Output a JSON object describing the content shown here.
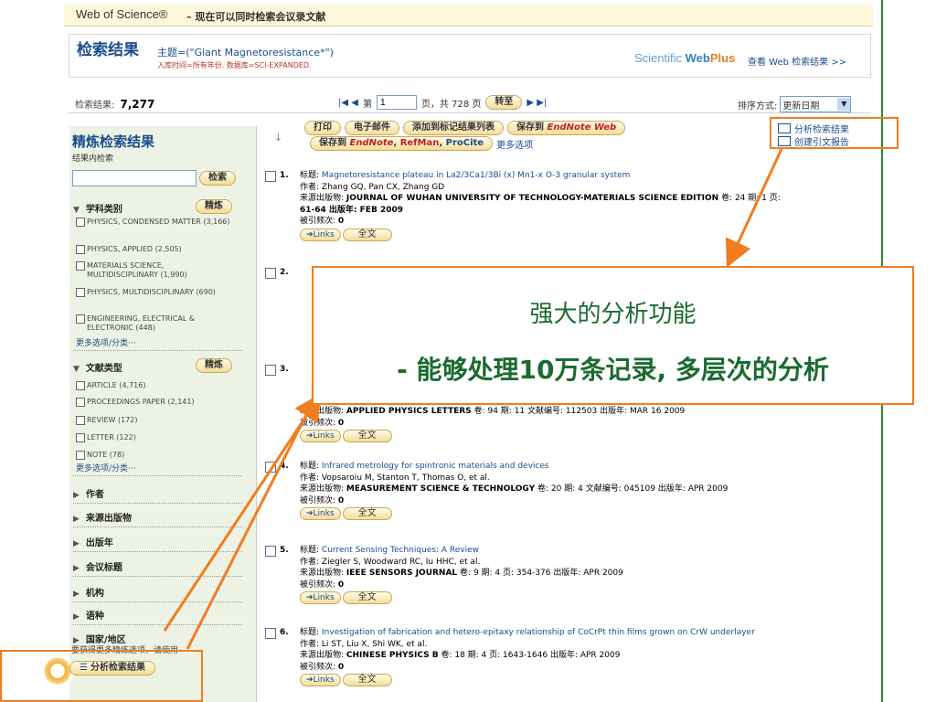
{
  "header": {
    "brand": "Web of Science®",
    "subtitle": "– 现在可以同时检索会议录文献"
  },
  "result_header": {
    "title": "检索结果",
    "query": "主题=(\"Giant Magnetoresistance*\")",
    "meta": "入库时间=所有年份. 数据库=SCI-EXPANDED.",
    "webplus_scientific": "Scientific ",
    "webplus_web": "Web",
    "webplus_plus": "Plus",
    "webplus_link": "查看 Web 检索结果 >>"
  },
  "countbar": {
    "label": "检索结果:",
    "count": "7,277",
    "prev_icon": "|◀ ◀",
    "page_prefix": "第",
    "page_value": "1",
    "page_suffix": "页，共 728 页",
    "goto_label": "转至",
    "next_icon": "▶ ▶|",
    "sort_label": "排序方式:",
    "sort_value": "更新日期"
  },
  "sidebar": {
    "title": "精炼检索结果",
    "subtitle": "结果内检索",
    "search_button": "检索",
    "category_section": "学科类别",
    "refine_button": "精炼",
    "categories": [
      "PHYSICS, CONDENSED MATTER (3,166)",
      "PHYSICS, APPLIED (2,505)",
      "MATERIALS SCIENCE, MULTIDISCIPLINARY (1,990)",
      "PHYSICS, MULTIDISCIPLINARY (690)",
      "ENGINEERING, ELECTRICAL & ELECTRONIC (448)"
    ],
    "more_categories": "更多选项/分类···",
    "doctype_section": "文献类型",
    "doctypes": [
      "ARTICLE (4,716)",
      "PROCEEDINGS PAPER (2,141)",
      "REVIEW (172)",
      "LETTER (122)",
      "NOTE (78)"
    ],
    "more_doctypes": "更多选项/分类···",
    "collapsed": [
      "作者",
      "来源出版物",
      "出版年",
      "会议标题",
      "机构",
      "语种",
      "国家/地区"
    ],
    "hint": "要获得更多精炼选项，请使用",
    "analyze_button": "分析检索结果"
  },
  "actions": {
    "print": "打印",
    "email": "电子邮件",
    "add_marked": "添加到标记结果列表",
    "save_to": "保存到",
    "endnote_web": "EndNote Web",
    "save_to2": "保存到",
    "endnote": "EndNote",
    "refman": "RefMan",
    "procite": "ProCite",
    "more_options": "更多选项"
  },
  "tools": {
    "analyze": "分析检索结果",
    "citation_report": "创建引文报告"
  },
  "labels": {
    "title": "标题:",
    "author": "作者:",
    "source": "来源出版物:",
    "cited": "被引频次:",
    "links": "➔Links",
    "fulltext": "全文"
  },
  "records": [
    {
      "num": "1.",
      "title": "Magnetoresistance plateau in La2/3Ca1/3Bi (x) Mn1-x O-3 granular system",
      "authors": "Zhang GQ, Pan CX, Zhang GD",
      "journal": "JOURNAL OF WUHAN UNIVERSITY OF TECHNOLOGY-MATERIALS SCIENCE EDITION",
      "details": "卷: 24   期: 1   页:",
      "details2": "61-64   出版年: FEB 2009",
      "cited": "0"
    },
    {
      "num": "2.",
      "title": "",
      "authors": "",
      "journal": "",
      "details": "",
      "details2": "",
      "cited": ""
    },
    {
      "num": "3.",
      "title": "",
      "authors": "",
      "journal": "APPLIED PHYSICS LETTERS",
      "details": "卷: 94   期: 11 文献编号: 112503   出版年: MAR 16 2009",
      "details2": "",
      "cited": "0"
    },
    {
      "num": "4.",
      "title": "Infrared metrology for spintronic materials and devices",
      "authors": "Vopsaroiu M, Stanton T, Thomas O, et al.",
      "journal": "MEASUREMENT SCIENCE & TECHNOLOGY",
      "details": "卷: 20   期: 4 文献编号: 045109   出版年: APR 2009",
      "details2": "",
      "cited": "0"
    },
    {
      "num": "5.",
      "title": "Current Sensing Techniques: A Review",
      "authors": "Ziegler S, Woodward RC, Iu HHC, et al.",
      "journal": "IEEE SENSORS JOURNAL",
      "details": "卷: 9   期: 4   页: 354-376   出版年: APR 2009",
      "details2": "",
      "cited": "0"
    },
    {
      "num": "6.",
      "title": "Investigation of fabrication and hetero-epitaxy relationship of CoCrPt thin films grown on CrW underlayer",
      "authors": "Li ST, Liu X, Shi WK, et al.",
      "journal": "CHINESE PHYSICS B",
      "details": "卷: 18   期: 4   页: 1643-1646   出版年: APR 2009",
      "details2": "",
      "cited": "0"
    }
  ],
  "callout": {
    "line1": "强大的分析功能",
    "line2": "- 能够处理10万条记录, 多层次的分析"
  },
  "colors": {
    "accent_orange": "#f07d20",
    "link_blue": "#1a4d8f",
    "callout_green": "#1a6b2f",
    "sidebar_bg": "#edf3e4"
  }
}
